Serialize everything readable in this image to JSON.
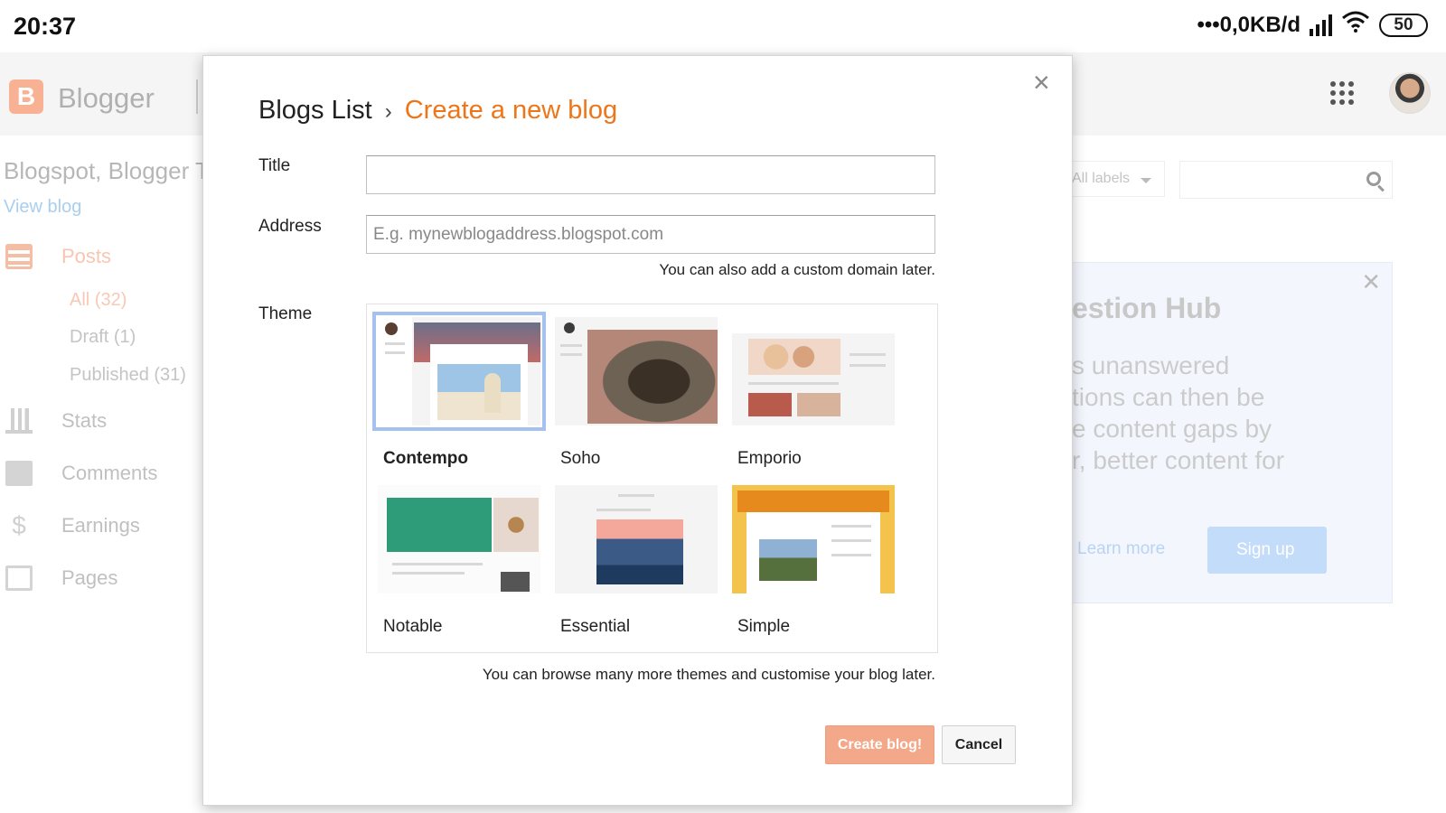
{
  "status_bar": {
    "time": "20:37",
    "network": "•••0,0KB/d",
    "battery": "50"
  },
  "background": {
    "app_name": "Blogger",
    "blog_title": "Blogspot, Blogger T",
    "view_blog": "View blog",
    "nav": {
      "posts": "Posts",
      "posts_sub": [
        "All (32)",
        "Draft (1)",
        "Published (31)"
      ],
      "stats": "Stats",
      "comments": "Comments",
      "earnings": "Earnings",
      "pages": "Pages"
    },
    "labels_filter": "All labels",
    "promo": {
      "title": "estion Hub",
      "lines": [
        "s unanswered",
        "tions can then be",
        "e content gaps by",
        "r, better content for"
      ],
      "learn_more": "Learn more",
      "sign_up": "Sign up"
    }
  },
  "dialog": {
    "breadcrumb_root": "Blogs List",
    "breadcrumb_sep": "›",
    "breadcrumb_current": "Create a new blog",
    "close": "×",
    "title_label": "Title",
    "title_value": "",
    "address_label": "Address",
    "address_placeholder": "E.g. mynewblogaddress.blogspot.com",
    "address_hint": "You can also add a custom domain later.",
    "theme_label": "Theme",
    "themes": [
      {
        "name": "Contempo",
        "selected": true
      },
      {
        "name": "Soho",
        "selected": false
      },
      {
        "name": "Emporio",
        "selected": false
      },
      {
        "name": "Notable",
        "selected": false
      },
      {
        "name": "Essential",
        "selected": false
      },
      {
        "name": "Simple",
        "selected": false
      }
    ],
    "browse_hint": "You can browse many more themes and customise your blog later.",
    "create_button": "Create blog!",
    "cancel_button": "Cancel"
  },
  "colors": {
    "accent_orange": "#ee7518",
    "create_button_bg": "#f4a88a",
    "selected_outline": "#a5c1ef"
  }
}
